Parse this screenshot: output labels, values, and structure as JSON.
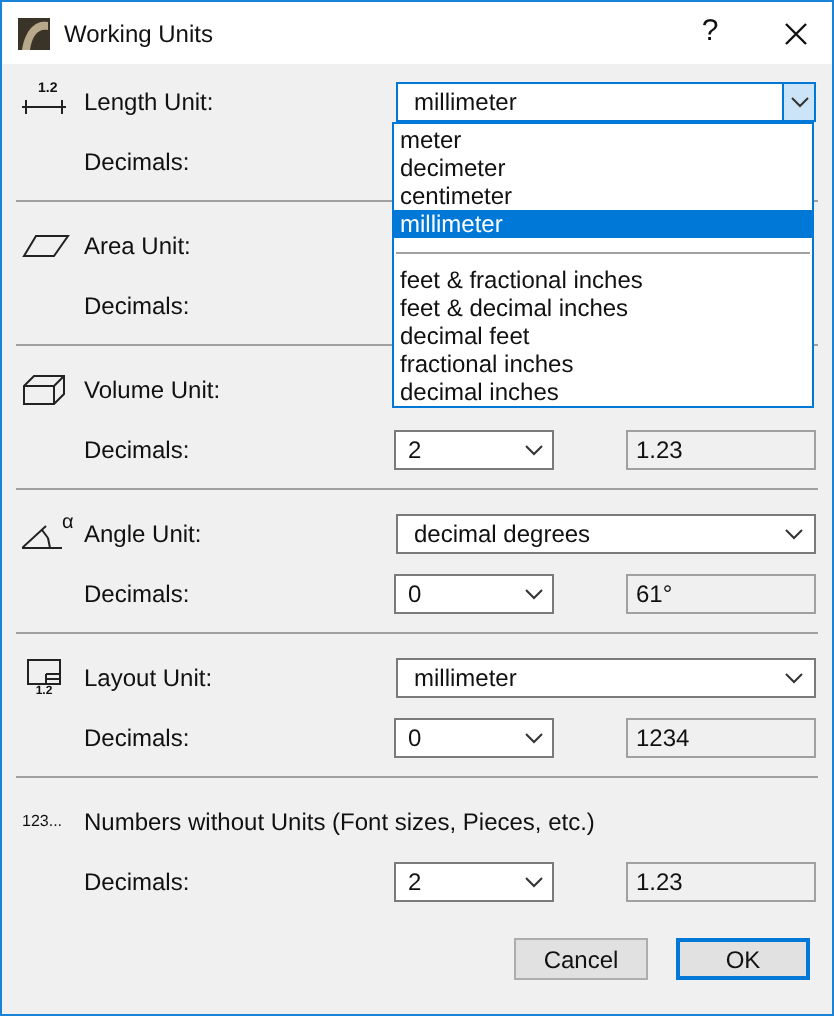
{
  "window": {
    "title": "Working Units",
    "help": "?"
  },
  "sections": [
    {
      "kind": "length",
      "icon_label": "1.2",
      "label": "Length Unit:",
      "unit": {
        "value": "millimeter",
        "open": true
      },
      "decimals_label": "Decimals:"
    },
    {
      "kind": "area",
      "label": "Area Unit:",
      "decimals_label": "Decimals:"
    },
    {
      "kind": "volume",
      "label": "Volume Unit:",
      "decimals_label": "Decimals:",
      "decimals": "2",
      "sample": "1.23"
    },
    {
      "kind": "angle",
      "icon_label": "α",
      "label": "Angle Unit:",
      "unit": {
        "value": "decimal degrees",
        "open": false
      },
      "decimals_label": "Decimals:",
      "decimals": "0",
      "sample": "61°"
    },
    {
      "kind": "layout",
      "icon_label": "1.2",
      "label": "Layout Unit:",
      "unit": {
        "value": "millimeter",
        "open": false
      },
      "decimals_label": "Decimals:",
      "decimals": "0",
      "sample": "1234"
    },
    {
      "kind": "numbers",
      "icon_label": "123...",
      "label": "Numbers without Units (Font sizes, Pieces, etc.)",
      "decimals_label": "Decimals:",
      "decimals": "2",
      "sample": "1.23"
    }
  ],
  "dropdown_list": [
    {
      "kind": "option",
      "label": "meter",
      "selected": false
    },
    {
      "kind": "option",
      "label": "decimeter",
      "selected": false
    },
    {
      "kind": "option",
      "label": "centimeter",
      "selected": false
    },
    {
      "kind": "option",
      "label": "millimeter",
      "selected": true
    },
    {
      "kind": "separator"
    },
    {
      "kind": "option",
      "label": "feet & fractional inches",
      "selected": false
    },
    {
      "kind": "option",
      "label": "feet & decimal inches",
      "selected": false
    },
    {
      "kind": "option",
      "label": "decimal feet",
      "selected": false
    },
    {
      "kind": "option",
      "label": "fractional inches",
      "selected": false
    },
    {
      "kind": "option",
      "label": "decimal inches",
      "selected": false
    }
  ],
  "buttons": [
    {
      "label": "Cancel",
      "default": false
    },
    {
      "label": "OK",
      "default": true
    }
  ]
}
